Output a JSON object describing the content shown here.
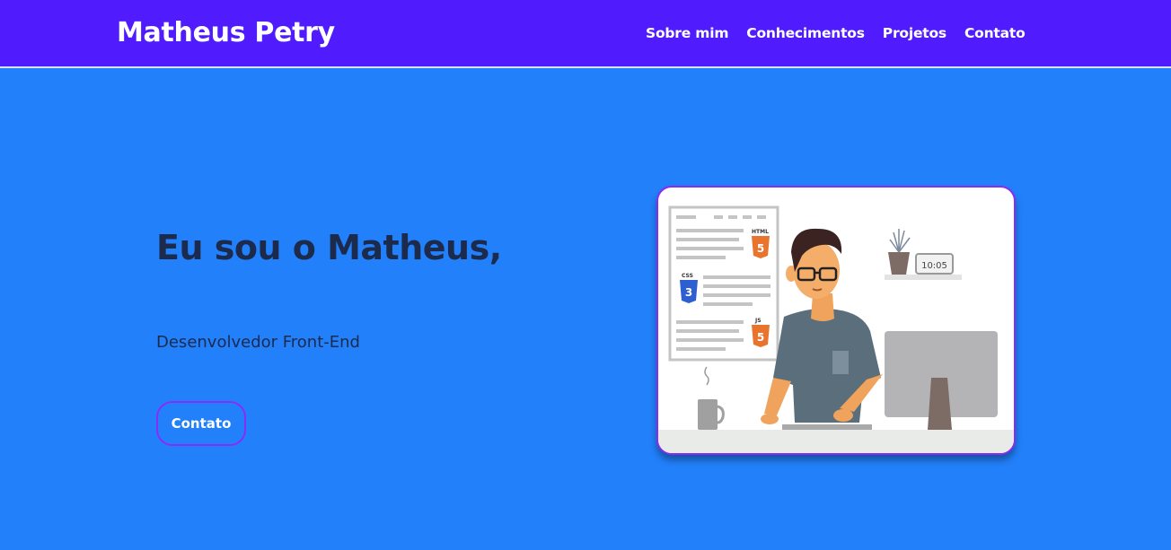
{
  "header": {
    "brand": "Matheus Petry",
    "nav": [
      {
        "label": "Sobre mim"
      },
      {
        "label": "Conhecimentos"
      },
      {
        "label": "Projetos"
      },
      {
        "label": "Contato"
      }
    ]
  },
  "hero": {
    "title": "Eu sou o Matheus,",
    "subtitle": "Desenvolvedor Front-End",
    "cta_label": "Contato",
    "illustration": {
      "html_badge": "HTML",
      "css_badge": "CSS",
      "js_badge": "JS",
      "clock": "10:05"
    }
  },
  "colors": {
    "navbar": "#501cfd",
    "page_background": "#2280fb",
    "heading_text": "#1c2a4b",
    "button_border": "#8b2bf7"
  }
}
